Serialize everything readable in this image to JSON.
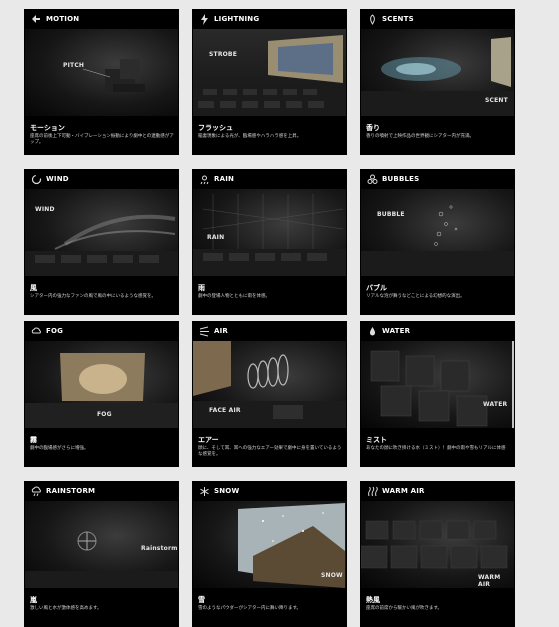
{
  "cards": [
    {
      "name": "MOTION",
      "jp": "モーション",
      "desc": "座席の前後上下可動・バイブレーション振動により劇中との連動感がアップ。",
      "img_label": "PITCH",
      "icon": "motion-icon"
    },
    {
      "name": "LIGHTNING",
      "jp": "フラッシュ",
      "desc": "稲妻現象による光が、臨場感やハラハラ感を上昇。",
      "img_label": "STROBE",
      "icon": "lightning-icon"
    },
    {
      "name": "SCENTS",
      "jp": "香り",
      "desc": "香りの噴射で上映作品の世界観にシアター内が充満。",
      "img_label": "SCENT",
      "icon": "scents-icon"
    },
    {
      "name": "WIND",
      "jp": "風",
      "desc": "シアター内の強力なファンの風で風の中にいるような感覚を。",
      "img_label": "WIND",
      "icon": "wind-icon"
    },
    {
      "name": "RAIN",
      "jp": "雨",
      "desc": "劇中の登場人物とともに雨を体感。",
      "img_label": "RAIN",
      "icon": "rain-icon"
    },
    {
      "name": "BUBBLES",
      "jp": "バブル",
      "desc": "リアルな泡が舞うなどことによる幻想的な演出。",
      "img_label": "BUBBLE",
      "icon": "bubbles-icon"
    },
    {
      "name": "FOG",
      "jp": "霧",
      "desc": "劇中の臨場感がさらに増強。",
      "img_label": "FOG",
      "icon": "fog-icon"
    },
    {
      "name": "AIR",
      "jp": "エアー",
      "desc": "顔に、そして耳、耳への強力なエアー効果で劇中に身を置いているような感覚を。",
      "img_label": "FACE AIR",
      "icon": "air-icon"
    },
    {
      "name": "WATER",
      "jp": "ミスト",
      "desc": "あなたの顔に吹き掛ける水（ミスト）！劇中の雨や雪もリアルに体感",
      "img_label": "WATER",
      "icon": "water-icon"
    },
    {
      "name": "RAINSTORM",
      "jp": "嵐",
      "desc": "激しい風と水が激体感を高めます。",
      "img_label": "Rainstorm",
      "icon": "rainstorm-icon"
    },
    {
      "name": "SNOW",
      "jp": "雪",
      "desc": "雪のようなパウダーがシアター内に舞い降ります。",
      "img_label": "SNOW",
      "icon": "snow-icon"
    },
    {
      "name": "WARM AIR",
      "jp": "熱風",
      "desc": "座席の前席から暖かい風が吹きます。",
      "img_label": "WARM AIR",
      "icon": "warm-air-icon"
    }
  ]
}
